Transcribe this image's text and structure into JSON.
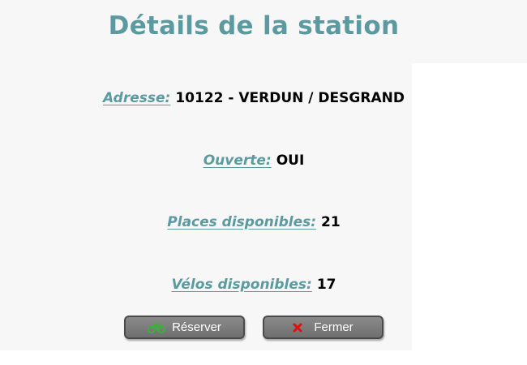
{
  "page": {
    "title": "Détails de la station"
  },
  "details": {
    "address_label": "Adresse:",
    "address_value": "10122 - VERDUN / DESGRAND",
    "open_label": "Ouverte:",
    "open_value": "OUI",
    "places_label": "Places disponibles:",
    "places_value": "21",
    "bikes_label": "Vélos disponibles:",
    "bikes_value": "17"
  },
  "buttons": {
    "reserve_label": "Réserver",
    "reserve_icon": "bicycle-icon",
    "close_label": "Fermer",
    "close_icon": "close-icon"
  },
  "colors": {
    "accent": "#5b9aa0",
    "button": "#7a7a7a",
    "bicycle_icon": "#3fae3f",
    "close_icon": "#e01010"
  }
}
